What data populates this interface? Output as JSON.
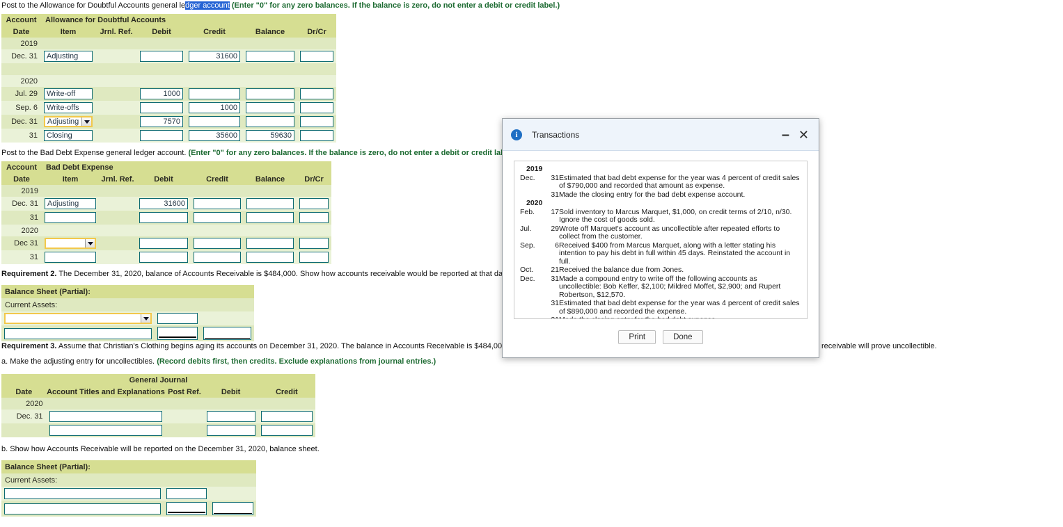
{
  "instructions": {
    "line1_pre": "Post to the Allowance for Doubtful Accounts general le",
    "line1_sel": "dger account",
    "line1_bold": "(Enter \"0\" for any zero balances. If the balance is zero, do not enter a debit or credit label.)",
    "line2_pre": "Post to the Bad Debt Expense general ledger account. ",
    "line2_bold": "(Enter \"0\" for any zero balances. If the balance is zero, do not enter a debit or credit label.)",
    "req2": "Requirement 2. The December 31, 2020, balance of Accounts Receivable is $484,000. Show how accounts receivable would be reported at that date.",
    "req2_label": "Requirement 2.",
    "req3_label": "Requirement 3.",
    "req3_left": "Assume that Christian's Clothing begins aging its accounts on December 31, 2020. The balance in Accounts Receivable is $484,000, the credit balanc",
    "req3_right": "receivable will prove uncollectible.",
    "req3a_pre": "a.  Make the adjusting entry for uncollectibles. ",
    "req3a_bold": "(Record debits first, then credits. Exclude explanations from journal entries.)",
    "req3b": "b. Show how Accounts Receivable will be reported on the December 31, 2020, balance sheet."
  },
  "ledger_headers": {
    "account": "Account",
    "columns": [
      "Date",
      "Item",
      "Jrnl. Ref.",
      "Debit",
      "Credit",
      "Balance",
      "Dr/Cr"
    ]
  },
  "ledger_allowance": {
    "account_title": "Allowance for Doubtful Accounts",
    "rows": [
      {
        "type": "year",
        "date": "2019"
      },
      {
        "type": "entry",
        "date": "Dec. 31",
        "item": "Adjusting",
        "item_kind": "input",
        "jrnl": "",
        "debit": "",
        "credit": "31600",
        "balance": "",
        "drcr": ""
      },
      {
        "type": "blank",
        "date": ""
      },
      {
        "type": "year",
        "date": "2020"
      },
      {
        "type": "entry",
        "date": "Jul. 29",
        "item": "Write-off",
        "item_kind": "input",
        "jrnl": "",
        "debit": "1000",
        "credit": "",
        "balance": "",
        "drcr": ""
      },
      {
        "type": "entry",
        "date": "Sep. 6",
        "item": "Write-offs",
        "item_kind": "input",
        "jrnl": "",
        "debit": "",
        "credit": "1000",
        "balance": "",
        "drcr": ""
      },
      {
        "type": "entry",
        "date": "Dec. 31",
        "item": "Adjusting",
        "item_kind": "select",
        "jrnl": "",
        "debit": "7570",
        "credit": "",
        "balance": "",
        "drcr": ""
      },
      {
        "type": "entry",
        "date": "31",
        "item": "Closing",
        "item_kind": "input",
        "jrnl": "",
        "debit": "",
        "credit": "35600",
        "balance": "59630",
        "drcr": ""
      }
    ]
  },
  "ledger_baddebt": {
    "account_title": "Bad Debt Expense",
    "rows": [
      {
        "type": "year",
        "date": "2019"
      },
      {
        "type": "entry",
        "date": "Dec. 31",
        "item": "Adjusting",
        "item_kind": "input",
        "jrnl": "",
        "debit": "31600",
        "credit": "",
        "balance": "",
        "drcr": ""
      },
      {
        "type": "entry",
        "date": "31",
        "item": "",
        "item_kind": "input",
        "jrnl": "",
        "debit": "",
        "credit": "",
        "balance": "",
        "drcr": ""
      },
      {
        "type": "year",
        "date": "2020"
      },
      {
        "type": "entry",
        "date": "Dec 31",
        "item": "",
        "item_kind": "select",
        "jrnl": "",
        "debit": "",
        "credit": "",
        "balance": "",
        "drcr": ""
      },
      {
        "type": "entry",
        "date": "31",
        "item": "",
        "item_kind": "input",
        "jrnl": "",
        "debit": "",
        "credit": "",
        "balance": "",
        "drcr": ""
      }
    ]
  },
  "balance_sheet_req2": {
    "heading": "Balance Sheet (Partial):",
    "subheading": "Current Assets:",
    "row1": {
      "label": "",
      "label_kind": "select",
      "amount": "",
      "total": ""
    },
    "row2": {
      "label": "",
      "label_kind": "input",
      "amount": "",
      "total": ""
    }
  },
  "balance_sheet_req3b": {
    "heading": "Balance Sheet (Partial):",
    "subheading": "Current Assets:",
    "row1": {
      "label": "",
      "amount": "",
      "total": ""
    },
    "row2": {
      "label": "",
      "amount": "",
      "total": ""
    }
  },
  "general_journal": {
    "title": "General Journal",
    "columns": [
      "Date",
      "Account Titles and Explanations",
      "Post Ref.",
      "Debit",
      "Credit"
    ],
    "rows": [
      {
        "type": "year",
        "date": "2020"
      },
      {
        "type": "entry",
        "date": "Dec. 31",
        "account": "",
        "postref": "",
        "debit": "",
        "credit": ""
      },
      {
        "type": "entry",
        "date": "",
        "account": "",
        "postref": "",
        "debit": "",
        "credit": ""
      }
    ]
  },
  "dialog": {
    "title": "Transactions",
    "info_icon": "info-icon",
    "minimize_label": "–",
    "close_label": "✕",
    "print_label": "Print",
    "done_label": "Done",
    "entries": [
      {
        "month": "2019",
        "day": "",
        "text": "",
        "is_year": true
      },
      {
        "month": "Dec.",
        "day": "31",
        "text": "Estimated that bad debt expense for the year was 4 percent of credit sales of $790,000 and recorded that amount as expense."
      },
      {
        "month": "",
        "day": "31",
        "text": "Made the closing entry for the bad debt expense account."
      },
      {
        "month": "2020",
        "day": "",
        "text": "",
        "is_year": true
      },
      {
        "month": "Feb.",
        "day": "17",
        "text": "Sold inventory to Marcus Marquet, $1,000, on credit terms of 2/10, n/30. Ignore the cost of goods sold."
      },
      {
        "month": "Jul.",
        "day": "29",
        "text": "Wrote off Marquet's account as uncollectible after repeated efforts to collect from the customer."
      },
      {
        "month": "Sep.",
        "day": "6",
        "text": "Received $400 from Marcus Marquet, along with a letter stating his intention to pay his debt in full within 45 days. Reinstated the account in full."
      },
      {
        "month": "Oct.",
        "day": "21",
        "text": "Received the balance due from Jones."
      },
      {
        "month": "Dec.",
        "day": "31",
        "text": "Made a compound entry to write off the following accounts as uncollectible: Bob Keffer, $2,100; Mildred Moffet, $2,900; and Rupert Robertson, $12,570."
      },
      {
        "month": "",
        "day": "31",
        "text": "Estimated that bad debt expense for the year was 4 percent of credit sales of $890,000 and recorded the expense."
      },
      {
        "month": "",
        "day": "31",
        "text": "Made the closing entry for the bad debt expense."
      }
    ]
  },
  "colors": {
    "header_band": "#d6de92",
    "row_alt_dark": "#dfe9c0",
    "row_alt_light": "#eaf2d8",
    "input_border": "#0e6b72",
    "focus_border": "#f2c84b",
    "green_text": "#1d6b32",
    "selection_blue": "#2563d4",
    "dialog_titlebar": "#eef4fb",
    "info_blue": "#1f6fc4"
  }
}
